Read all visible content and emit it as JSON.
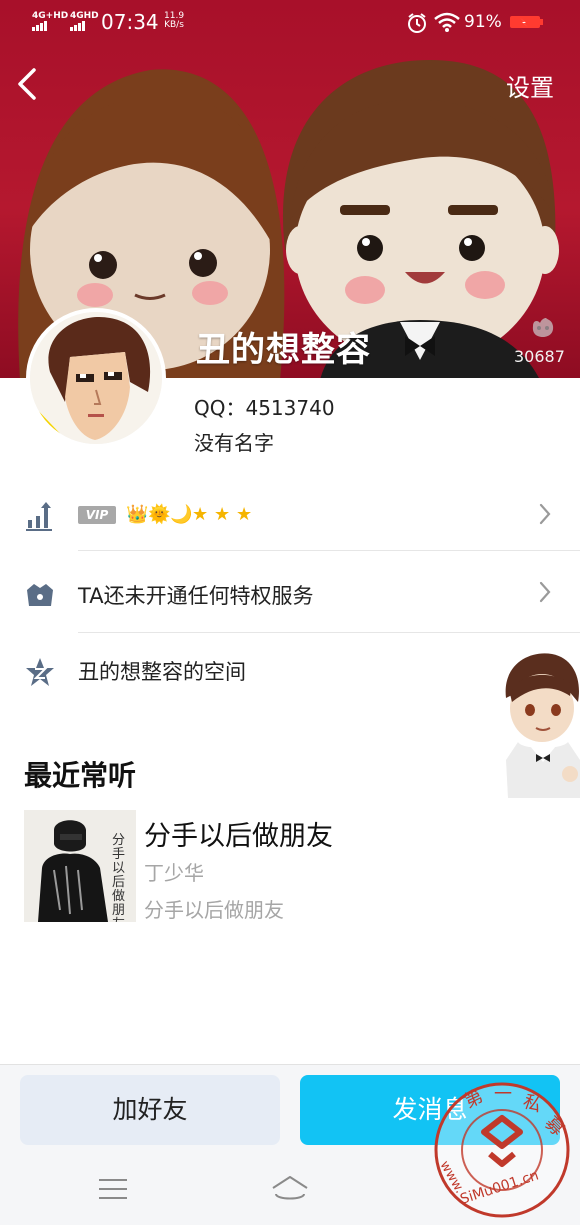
{
  "status_bar": {
    "network1": "4G+HD",
    "network2": "4GHD",
    "time": "07:34",
    "speed_value": "11.9",
    "speed_unit": "KB/s",
    "battery": "91%"
  },
  "header": {
    "settings_label": "设置"
  },
  "profile": {
    "nickname": "丑的想整容",
    "like_count": "30687",
    "qq_label": "QQ：",
    "qq_number": "4513740",
    "remark": "没有名字"
  },
  "rows": {
    "vip_tag": "VIP",
    "privilege_text": "TA还未开通任何特权服务",
    "space_text": "丑的想整容的空间"
  },
  "recent": {
    "section_title": "最近常听",
    "song_title": "分手以后做朋友",
    "artist": "丁少华",
    "album": "分手以后做朋友",
    "cover_text": "分手以后做朋友"
  },
  "actions": {
    "add_friend": "加好友",
    "send_message": "发消息"
  },
  "watermark": {
    "chars": "第一私募",
    "url": "www.SiMu001.cn"
  },
  "colors": {
    "accent": "#12c3f4",
    "secondary_button": "#e6ecf5",
    "cover_red": "#b5182f",
    "icon_slate": "#5a6d86",
    "watermark_red": "#c0392b"
  }
}
